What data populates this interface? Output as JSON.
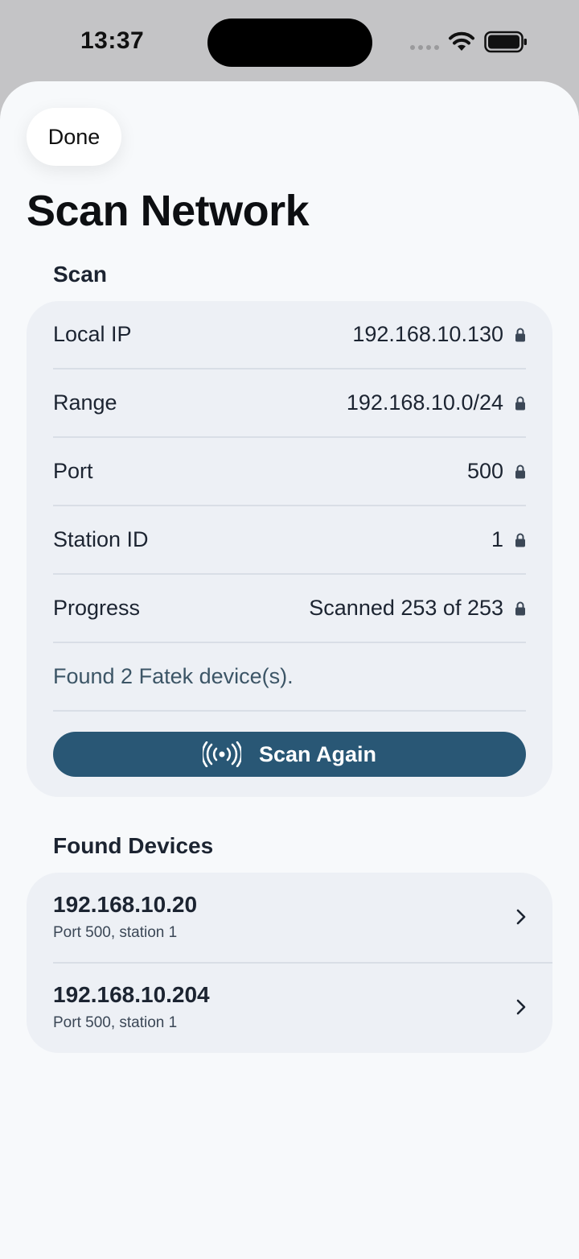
{
  "status_bar": {
    "time": "13:37"
  },
  "sheet": {
    "done_label": "Done",
    "title": "Scan Network"
  },
  "scan_section": {
    "header": "Scan",
    "rows": [
      {
        "label": "Local IP",
        "value": "192.168.10.130"
      },
      {
        "label": "Range",
        "value": "192.168.10.0/24"
      },
      {
        "label": "Port",
        "value": "500"
      },
      {
        "label": "Station ID",
        "value": "1"
      },
      {
        "label": "Progress",
        "value": "Scanned 253 of 253"
      }
    ],
    "found_message": "Found 2 Fatek device(s).",
    "scan_again_label": "Scan Again"
  },
  "devices_section": {
    "header": "Found Devices",
    "devices": [
      {
        "ip": "192.168.10.20",
        "detail": "Port 500, station 1"
      },
      {
        "ip": "192.168.10.204",
        "detail": "Port 500, station 1"
      }
    ]
  },
  "colors": {
    "accent": "#295775",
    "sheet_background": "#f7f9fb",
    "card_background": "#edf0f5"
  }
}
